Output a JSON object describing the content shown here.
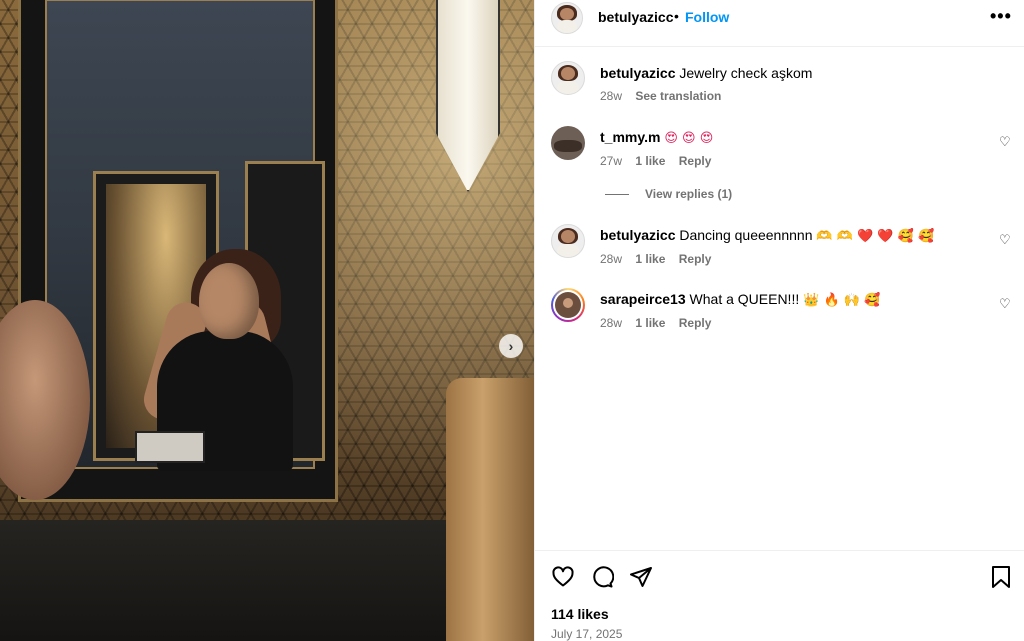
{
  "post": {
    "image_alt": "",
    "next_icon": "chevron-right-icon"
  },
  "header": {
    "username": "betulyazicc",
    "separator": "•",
    "follow_label": "Follow",
    "more_icon": "more-horizontal-icon"
  },
  "caption": {
    "username": "betulyazicc",
    "text": "Jewelry check aşkom",
    "age": "28w",
    "translate_label": "See translation"
  },
  "comments": [
    {
      "username": "t_mmy.m",
      "text": "",
      "emojis": "😍 😍 😍",
      "age": "27w",
      "likes": "1 like",
      "reply_label": "Reply",
      "view_replies": "View replies (1)"
    },
    {
      "username": "betulyazicc",
      "text": "Dancing queeennnnn",
      "emojis": "🫶 🫶 ❤️ ❤️ 🥰 🥰",
      "age": "28w",
      "likes": "1 like",
      "reply_label": "Reply"
    },
    {
      "username": "sarapeirce13",
      "text": "What a QUEEN!!!",
      "emojis": "👑 🔥 🙌 🥰",
      "age": "28w",
      "likes": "1 like",
      "reply_label": "Reply"
    }
  ],
  "actions": {
    "like_icon": "heart-icon",
    "comment_icon": "comment-icon",
    "share_icon": "send-icon",
    "save_icon": "bookmark-icon",
    "likes": "114 likes",
    "date": "July 17, 2025"
  }
}
